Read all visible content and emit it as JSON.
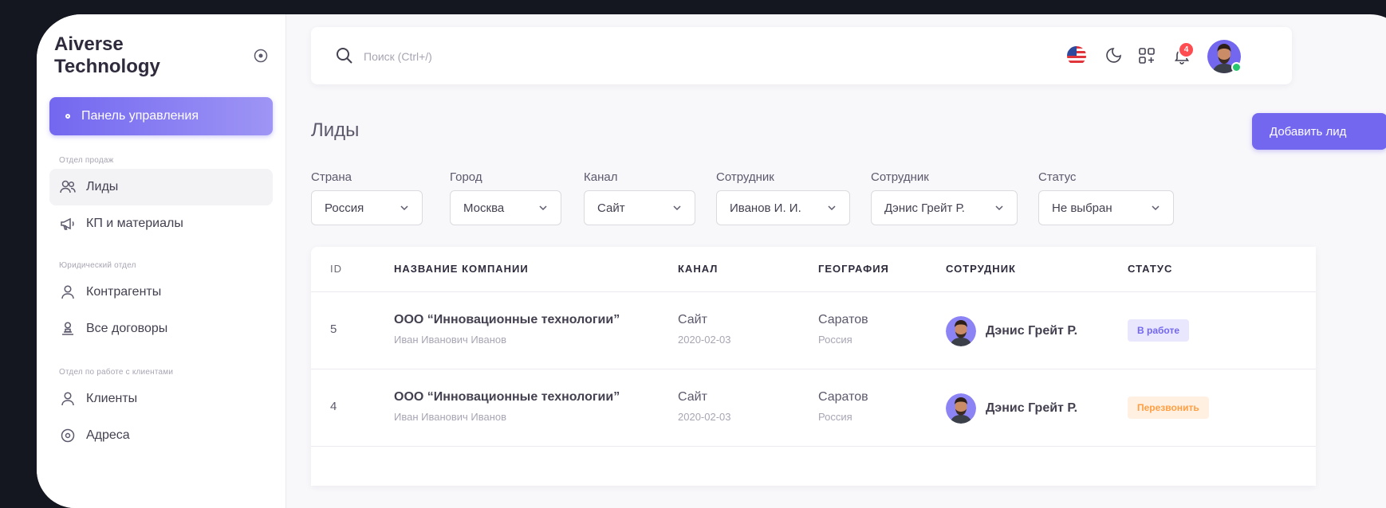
{
  "sidebar": {
    "brand": "Aiverse Technology",
    "active_item": "Панель управления",
    "sections": [
      {
        "title": "Отдел продаж",
        "items": [
          "Лиды",
          "КП и материалы"
        ]
      },
      {
        "title": "Юридический отдел",
        "items": [
          "Контрагенты",
          "Все договоры"
        ]
      },
      {
        "title": "Отдел по работе с клиентами",
        "items": [
          "Клиенты",
          "Адреса"
        ]
      }
    ]
  },
  "header": {
    "search_placeholder": "Поиск (Ctrl+/)",
    "notifications_count": "4"
  },
  "page": {
    "title": "Лиды",
    "add_button": "Добавить лид"
  },
  "filters": [
    {
      "label": "Страна",
      "value": "Россия"
    },
    {
      "label": "Город",
      "value": "Москва"
    },
    {
      "label": "Канал",
      "value": "Сайт"
    },
    {
      "label": "Сотрудник",
      "value": "Иванов И. И."
    },
    {
      "label": "Сотрудник",
      "value": "Дэнис Грейт Р."
    },
    {
      "label": "Статус",
      "value": "Не выбран"
    }
  ],
  "table": {
    "columns": [
      "ID",
      "НАЗВАНИЕ КОМПАНИИ",
      "КАНАЛ",
      "ГЕОГРАФИЯ",
      "СОТРУДНИК",
      "СТАТУС"
    ],
    "rows": [
      {
        "id": "5",
        "company": "ООО “Инновационные технологии”",
        "contact": "Иван Иванович Иванов",
        "channel": "Сайт",
        "date": "2020-02-03",
        "city": "Саратов",
        "country": "Россия",
        "employee": "Дэнис Грейт Р.",
        "status": "В работе"
      },
      {
        "id": "4",
        "company": "ООО “Инновационные технологии”",
        "contact": "Иван Иванович Иванов",
        "channel": "Сайт",
        "date": "2020-02-03",
        "city": "Саратов",
        "country": "Россия",
        "employee": "Дэнис Грейт Р.",
        "status": "Перезвонить"
      }
    ]
  },
  "colors": {
    "accent": "#7367f0",
    "status_work_bg": "#e9e7fd",
    "status_call_bg": "#fff0e1",
    "status_call_text": "#ff9f43",
    "badge": "#ff4c51",
    "online": "#28c76f"
  }
}
